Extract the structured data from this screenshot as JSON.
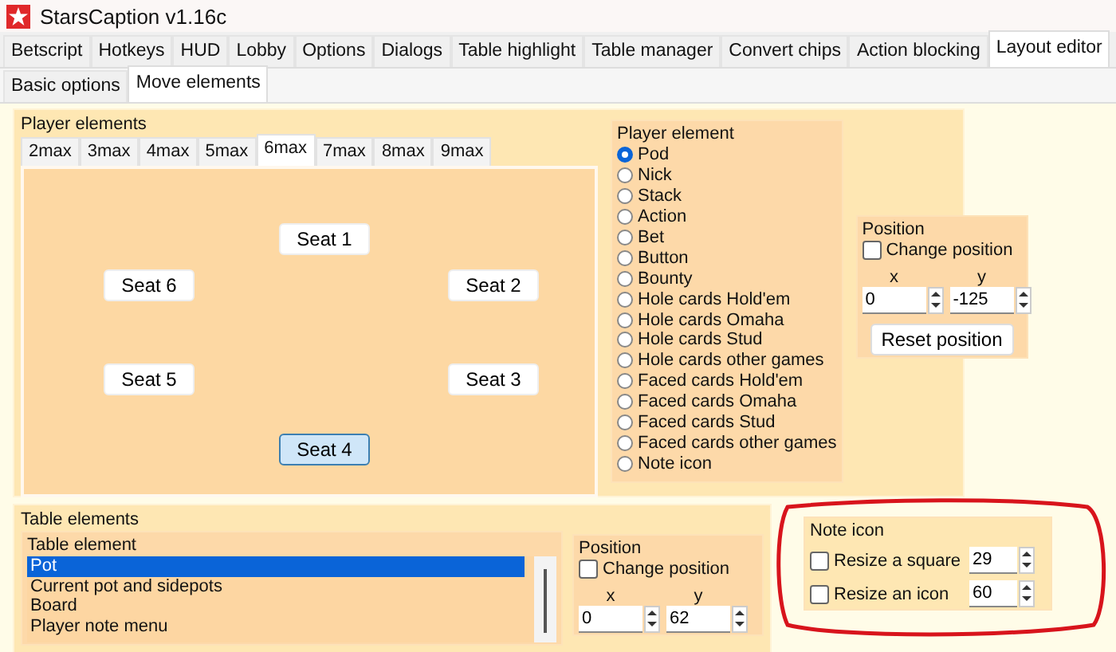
{
  "window": {
    "title": "StarsCaption v1.16c"
  },
  "tabs": [
    {
      "label": "Betscript",
      "selected": false
    },
    {
      "label": "Hotkeys",
      "selected": false
    },
    {
      "label": "HUD",
      "selected": false
    },
    {
      "label": "Lobby",
      "selected": false
    },
    {
      "label": "Options",
      "selected": false
    },
    {
      "label": "Dialogs",
      "selected": false
    },
    {
      "label": "Table highlight",
      "selected": false
    },
    {
      "label": "Table manager",
      "selected": false
    },
    {
      "label": "Convert chips",
      "selected": false
    },
    {
      "label": "Action blocking",
      "selected": false
    },
    {
      "label": "Layout editor",
      "selected": true
    }
  ],
  "subtabs": [
    {
      "label": "Basic options",
      "selected": false
    },
    {
      "label": "Move elements",
      "selected": true
    }
  ],
  "player_elements": {
    "title": "Player elements",
    "table_tabs": [
      {
        "label": "2max",
        "selected": false
      },
      {
        "label": "3max",
        "selected": false
      },
      {
        "label": "4max",
        "selected": false
      },
      {
        "label": "5max",
        "selected": false
      },
      {
        "label": "6max",
        "selected": true
      },
      {
        "label": "7max",
        "selected": false
      },
      {
        "label": "8max",
        "selected": false
      },
      {
        "label": "9max",
        "selected": false
      }
    ],
    "seats": [
      {
        "label": "Seat 1",
        "selected": false
      },
      {
        "label": "Seat 2",
        "selected": false
      },
      {
        "label": "Seat 3",
        "selected": false
      },
      {
        "label": "Seat 4",
        "selected": true
      },
      {
        "label": "Seat 5",
        "selected": false
      },
      {
        "label": "Seat 6",
        "selected": false
      }
    ],
    "player_element": {
      "title": "Player element",
      "options": [
        {
          "label": "Pod",
          "selected": true
        },
        {
          "label": "Nick",
          "selected": false
        },
        {
          "label": "Stack",
          "selected": false
        },
        {
          "label": "Action",
          "selected": false
        },
        {
          "label": "Bet",
          "selected": false
        },
        {
          "label": "Button",
          "selected": false
        },
        {
          "label": "Bounty",
          "selected": false
        },
        {
          "label": "Hole cards Hold'em",
          "selected": false
        },
        {
          "label": "Hole cards Omaha",
          "selected": false
        },
        {
          "label": "Hole cards Stud",
          "selected": false
        },
        {
          "label": "Hole cards other games",
          "selected": false
        },
        {
          "label": "Faced cards Hold'em",
          "selected": false
        },
        {
          "label": "Faced cards Omaha",
          "selected": false
        },
        {
          "label": "Faced cards Stud",
          "selected": false
        },
        {
          "label": "Faced cards other games",
          "selected": false
        },
        {
          "label": "Note icon",
          "selected": false
        }
      ]
    },
    "position": {
      "title": "Position",
      "change_position": {
        "label": "Change position",
        "checked": false
      },
      "x": {
        "label": "x",
        "value": "0"
      },
      "y": {
        "label": "y",
        "value": "-125"
      },
      "reset_button": "Reset position"
    }
  },
  "table_elements": {
    "title": "Table elements",
    "list": {
      "title": "Table element",
      "items": [
        {
          "label": "Pot",
          "selected": true
        },
        {
          "label": "Current pot and sidepots",
          "selected": false
        },
        {
          "label": "Board",
          "selected": false
        },
        {
          "label": "Player note menu",
          "selected": false
        }
      ]
    },
    "position": {
      "title": "Position",
      "change_position": {
        "label": "Change position",
        "checked": false
      },
      "x": {
        "label": "x",
        "value": "0"
      },
      "y": {
        "label": "y",
        "value": "62"
      }
    }
  },
  "note_icon": {
    "title": "Note icon",
    "options": [
      {
        "label": "Resize a square",
        "checked": false,
        "value": "29"
      },
      {
        "label": "Resize an icon",
        "checked": false,
        "value": "60"
      }
    ]
  }
}
